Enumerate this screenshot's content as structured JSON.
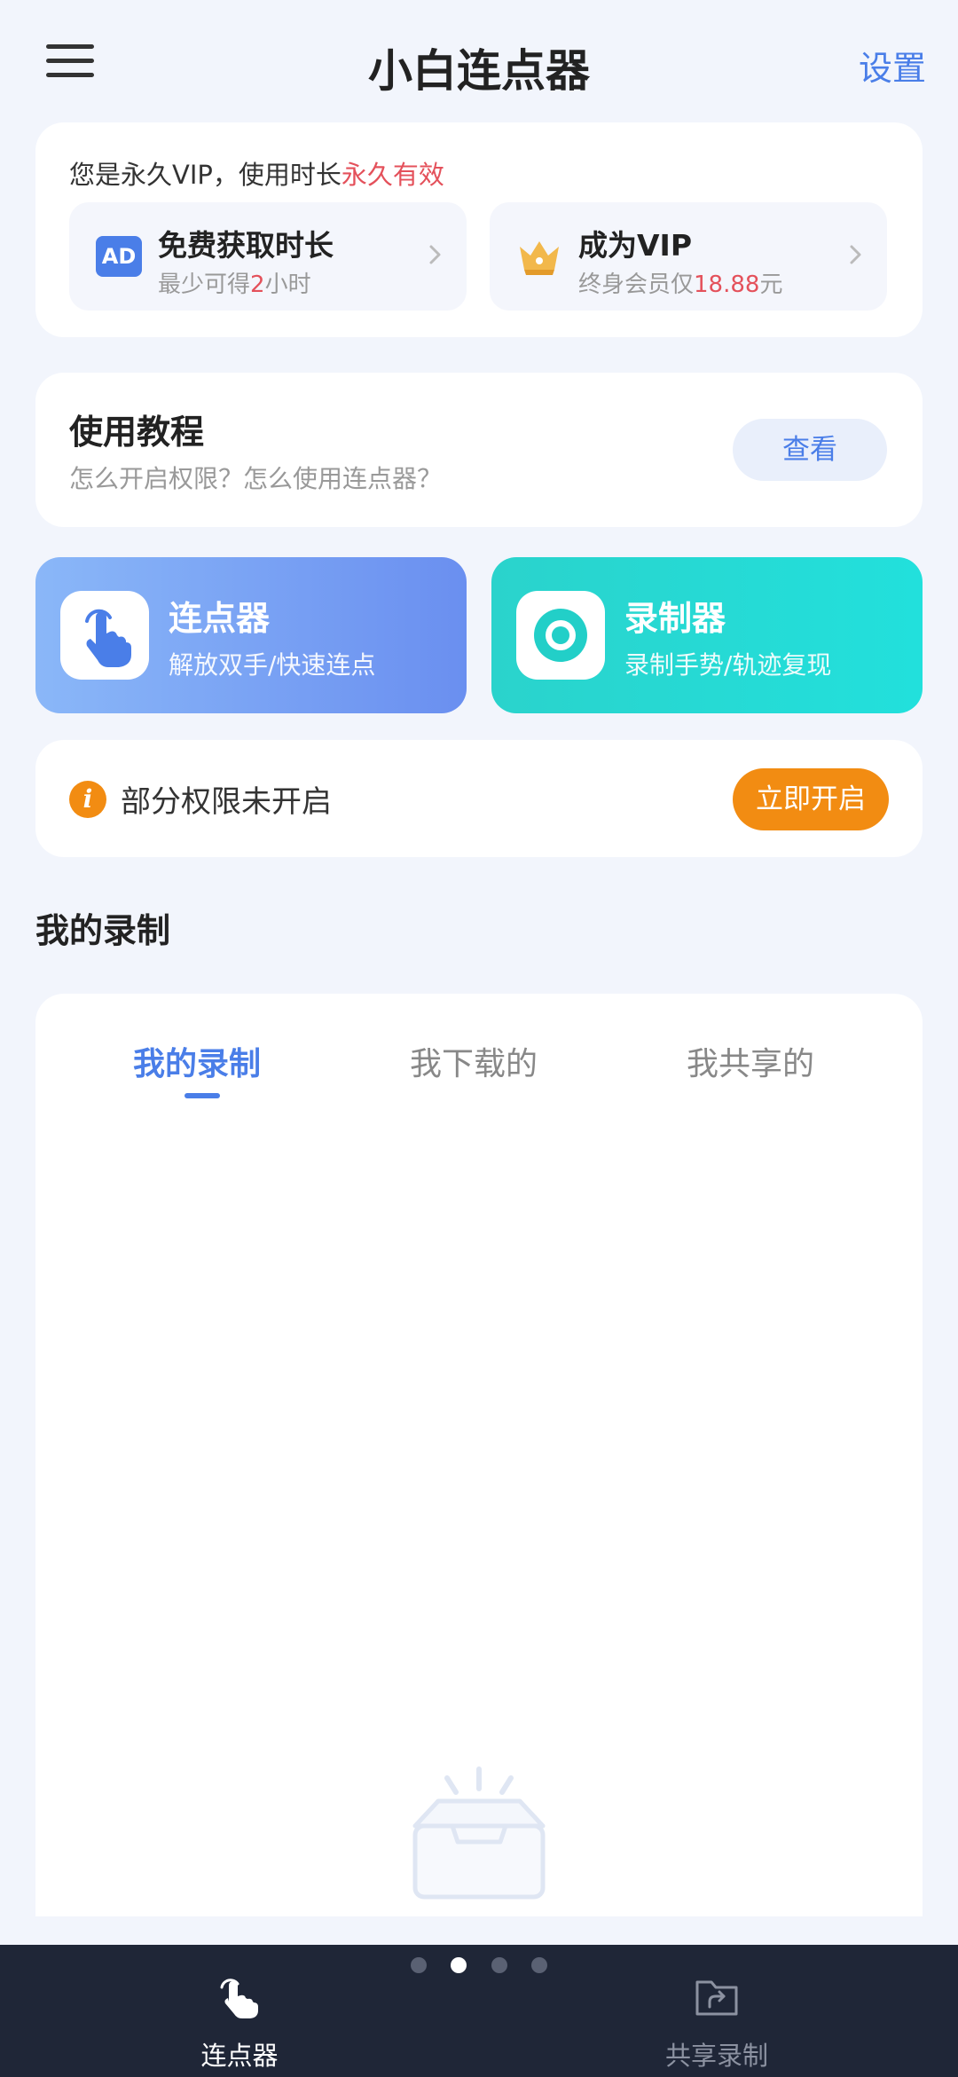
{
  "header": {
    "title": "小白连点器",
    "settings_label": "设置"
  },
  "vip": {
    "status_prefix": "您是永久VIP，使用时长",
    "status_value": "永久有效",
    "free_time": {
      "title": "免费获取时长",
      "desc_prefix": "最少可得",
      "desc_value": "2",
      "desc_suffix": "小时",
      "badge": "AD"
    },
    "become_vip": {
      "title": "成为VIP",
      "desc_prefix": "终身会员仅",
      "desc_value": "18.88",
      "desc_suffix": "元"
    }
  },
  "tutorial": {
    "title": "使用教程",
    "desc": "怎么开启权限？怎么使用连点器？",
    "button": "查看"
  },
  "features": {
    "clicker": {
      "title": "连点器",
      "desc": "解放双手/快速连点"
    },
    "recorder": {
      "title": "录制器",
      "desc": "录制手势/轨迹复现"
    }
  },
  "permission": {
    "text": "部分权限未开启",
    "button": "立即开启",
    "icon_glyph": "i"
  },
  "records": {
    "section_title": "我的录制",
    "tabs": [
      "我的录制",
      "我下载的",
      "我共享的"
    ],
    "active_tab": 0
  },
  "bottom_nav": {
    "items": [
      {
        "label": "连点器",
        "active": true
      },
      {
        "label": "共享录制",
        "active": false
      }
    ],
    "page_dots": 4,
    "active_dot": 1
  },
  "colors": {
    "accent": "#4a7ee8",
    "warning": "#f28c12",
    "highlight_red": "#e4515b",
    "nav_bg": "#1f2637"
  }
}
